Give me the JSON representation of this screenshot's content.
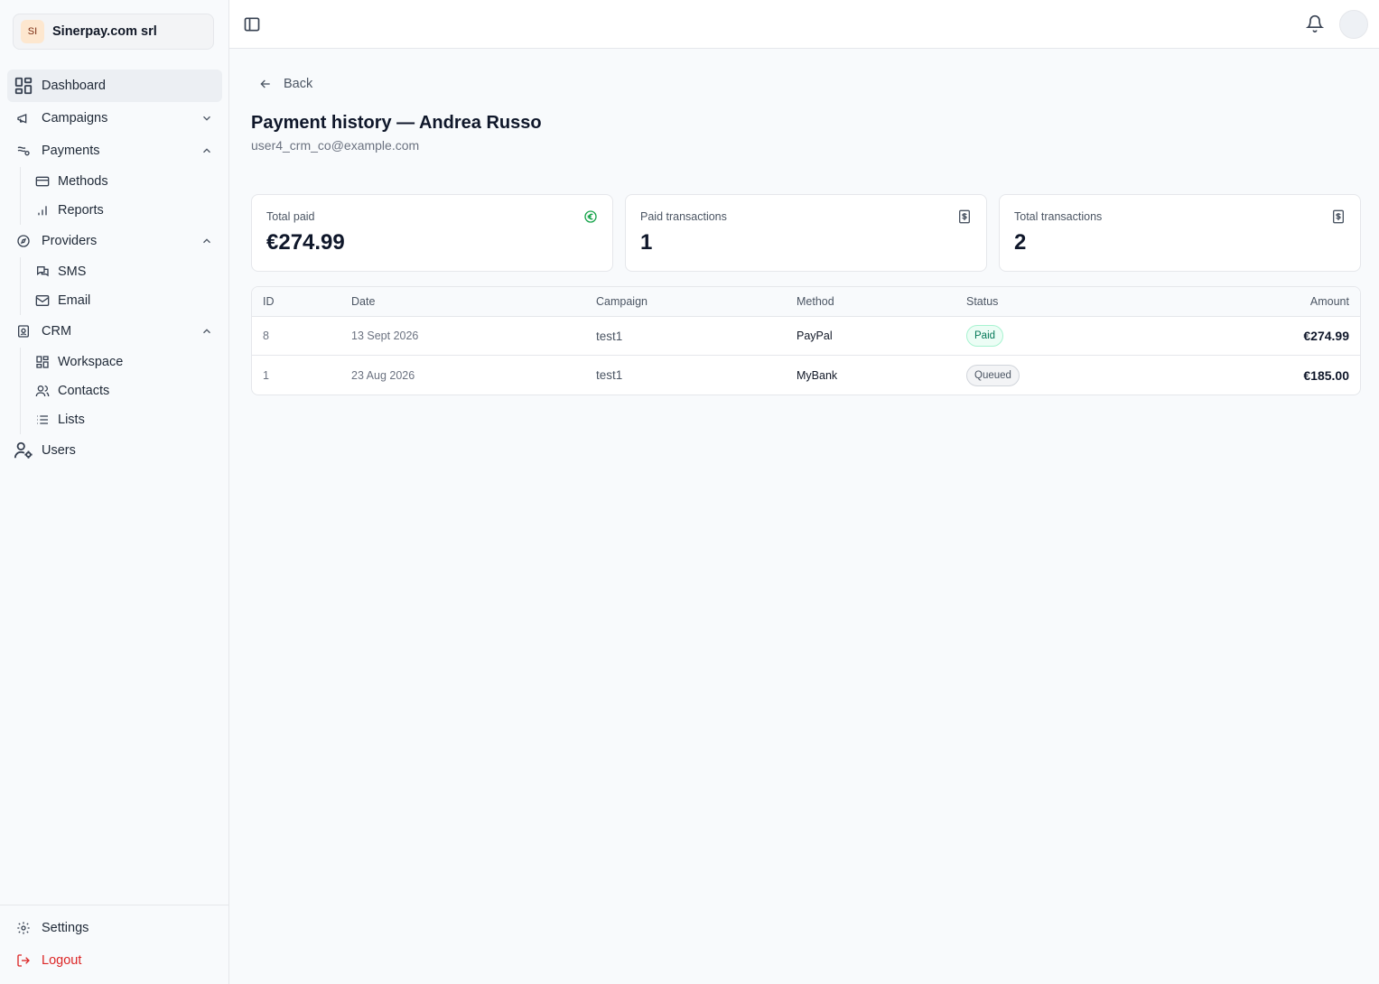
{
  "org": {
    "initials": "SI",
    "name": "Sinerpay.com srl"
  },
  "nav": {
    "dashboard": "Dashboard",
    "campaigns": "Campaigns",
    "payments": "Payments",
    "methods": "Methods",
    "reports": "Reports",
    "providers": "Providers",
    "sms": "SMS",
    "email": "Email",
    "crm": "CRM",
    "workspace": "Workspace",
    "contacts": "Contacts",
    "lists": "Lists",
    "users": "Users",
    "settings": "Settings",
    "logout": "Logout"
  },
  "page": {
    "back_label": "Back",
    "title": "Payment history — Andrea Russo",
    "email": "user4_crm_co@example.com"
  },
  "stats": {
    "total_paid": {
      "label": "Total paid",
      "value": "€274.99",
      "icon": "euro-circle-icon"
    },
    "paid_transactions": {
      "label": "Paid transactions",
      "value": "1",
      "icon": "dollar-receipt-icon"
    },
    "total_transactions": {
      "label": "Total transactions",
      "value": "2",
      "icon": "dollar-receipt-icon"
    }
  },
  "table": {
    "headers": {
      "id": "ID",
      "date": "Date",
      "campaign": "Campaign",
      "method": "Method",
      "status": "Status",
      "amount": "Amount"
    },
    "rows": [
      {
        "id": "8",
        "date": "13 Sept 2026",
        "campaign": "test1",
        "method": "PayPal",
        "status": "Paid",
        "amount": "€274.99"
      },
      {
        "id": "1",
        "date": "23 Aug 2026",
        "campaign": "test1",
        "method": "MyBank",
        "status": "Queued",
        "amount": "€185.00"
      }
    ]
  },
  "colors": {
    "accent_green": "#16a34a",
    "logout_red": "#dc2626",
    "sidebar_bg": "#f8fafc"
  }
}
